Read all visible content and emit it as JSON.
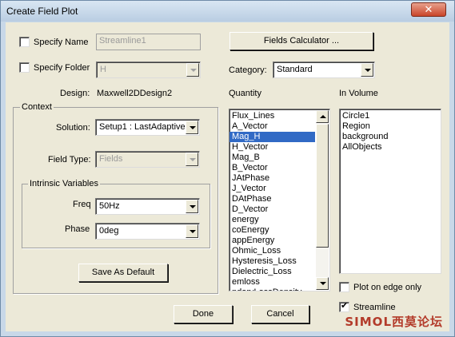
{
  "window": {
    "title": "Create Field Plot",
    "close_glyph": "✕"
  },
  "specify_name": {
    "label": "Specify Name",
    "value": "Streamline1",
    "checked": false
  },
  "specify_folder": {
    "label": "Specify Folder",
    "value": "H",
    "checked": false
  },
  "design": {
    "label": "Design:",
    "value": "Maxwell2DDesign2"
  },
  "fields_calculator": {
    "label": "Fields Calculator ..."
  },
  "category": {
    "label": "Category:",
    "value": "Standard"
  },
  "quantity": {
    "label": "Quantity",
    "items": [
      "Flux_Lines",
      "A_Vector",
      "Mag_H",
      "H_Vector",
      "Mag_B",
      "B_Vector",
      "JAtPhase",
      "J_Vector",
      "DAtPhase",
      "D_Vector",
      "energy",
      "coEnergy",
      "appEnergy",
      "Ohmic_Loss",
      "Hysteresis_Loss",
      "Dielectric_Loss",
      "emloss",
      "ndaryLossDensity"
    ],
    "selected": "Mag_H"
  },
  "in_volume": {
    "label": "In Volume",
    "items": [
      "Circle1",
      "Region",
      "background",
      "AllObjects"
    ]
  },
  "context": {
    "title": "Context",
    "solution_label": "Solution:",
    "solution_value": "Setup1 : LastAdaptive",
    "field_type_label": "Field Type:",
    "field_type_value": "Fields"
  },
  "intrinsic": {
    "title": "Intrinsic Variables",
    "freq_label": "Freq",
    "freq_value": "50Hz",
    "phase_label": "Phase",
    "phase_value": "0deg"
  },
  "save_default": {
    "label": "Save As Default"
  },
  "plot_on_edge": {
    "label": "Plot on edge only",
    "checked": false
  },
  "streamline": {
    "label": "Streamline",
    "checked": true
  },
  "done": {
    "label": "Done"
  },
  "cancel": {
    "label": "Cancel"
  },
  "watermark": {
    "text": "SIMOL西莫论坛"
  }
}
